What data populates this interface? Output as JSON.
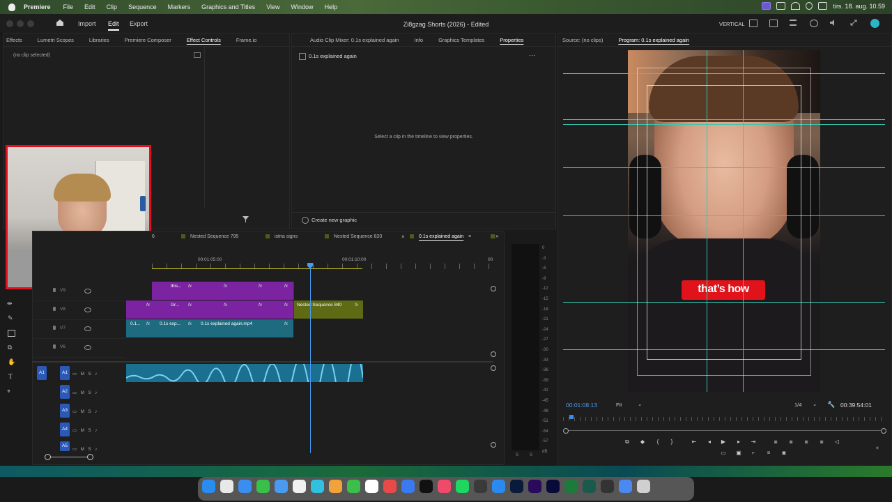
{
  "menubar": {
    "app": "Premiere",
    "items": [
      "File",
      "Edit",
      "Clip",
      "Sequence",
      "Markers",
      "Graphics and Titles",
      "View",
      "Window",
      "Help"
    ],
    "datetime": "tirs. 18. aug.  10.59"
  },
  "titlebar": {
    "tabs": [
      "Import",
      "Edit",
      "Export"
    ],
    "active_tab": "Edit",
    "title": "Zi8gzag Shorts (2026) - Edited",
    "workspace": "VERTICAL"
  },
  "left_panel": {
    "tabs": [
      "Effects",
      "Lumetri Scopes",
      "Libraries",
      "Premiere Composer",
      "Effect Controls",
      "Frame.io"
    ],
    "active_tab": "Effect Controls",
    "status": "(no clip selected)"
  },
  "center_panel": {
    "tabs": [
      "Audio Clip Mixer: 0.1s explained again",
      "Info",
      "Graphics Templates",
      "Properties"
    ],
    "active_tab": "Properties",
    "clip_name": "0.1s explained again",
    "hint": "Select a clip in the timeline to view properties.",
    "create_graphic": "Create new graphic"
  },
  "monitor": {
    "source_tab": "Source: (no clips)",
    "program_tab": "Program: 0.1s explained again",
    "caption": "that’s how",
    "timecode": "00:01:08:13",
    "fit": "Fit",
    "resolution": "1/4",
    "duration": "00:39:54:01"
  },
  "timeline": {
    "tabs": [
      "6",
      "Nested Sequence 795",
      "istria signs",
      "Nested Sequence 820",
      "0.1s explained again"
    ],
    "active_tab": "0.1s explained again",
    "ruler": [
      "00:01:05:00",
      "00:01:10:00",
      "00"
    ],
    "video_tracks": [
      "V9",
      "V8",
      "V7",
      "V6"
    ],
    "audio_tracks": [
      "A1",
      "A2",
      "A3",
      "A4",
      "A5"
    ],
    "src_patch": "A1",
    "clips": {
      "v9_label": "this...",
      "v8_label": "Gr...",
      "nested": "Nested Sequence 840",
      "v7_a": "0.1...",
      "v7_b": "0.1s exp...",
      "v7_c": "0.1s explained again.mp4",
      "fx": "fx"
    },
    "track_btn_m": "M",
    "track_btn_s": "S"
  },
  "meter": {
    "scale": [
      "0",
      "-3",
      "-6",
      "-9",
      "-12",
      "-15",
      "-18",
      "-21",
      "-24",
      "-27",
      "-30",
      "-33",
      "-36",
      "-39",
      "-42",
      "-45",
      "-48",
      "-51",
      "-54",
      "-57",
      "dB"
    ],
    "solo": [
      "S",
      "S"
    ]
  },
  "colors": {
    "accent": "#3a8ee6",
    "guide": "#38c7b0",
    "purple_clip": "#7b23a0",
    "teal_clip": "#1e6b80",
    "caption_bg": "#e0131b"
  }
}
